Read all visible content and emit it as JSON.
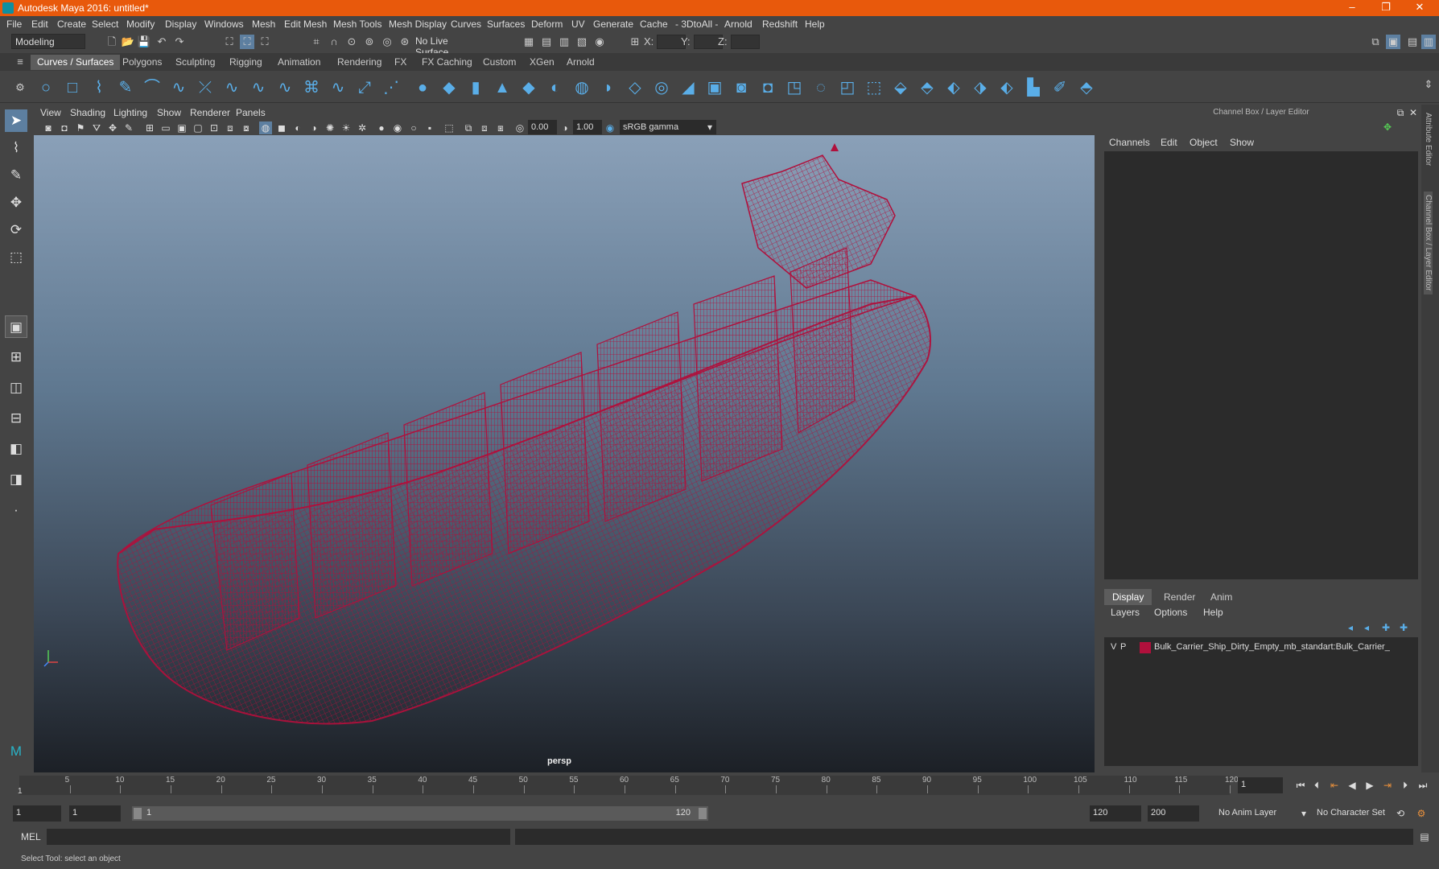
{
  "window": {
    "title": "Autodesk Maya 2016: untitled*"
  },
  "menus": [
    "File",
    "Edit",
    "Create",
    "Select",
    "Modify",
    "Display",
    "Windows",
    "Mesh",
    "Edit Mesh",
    "Mesh Tools",
    "Mesh Display",
    "Curves",
    "Surfaces",
    "Deform",
    "UV",
    "Generate",
    "Cache",
    "- 3DtoAll -",
    "Arnold",
    "Redshift",
    "Help"
  ],
  "toolbar": {
    "mode": "Modeling",
    "live_surface": "No Live Surface",
    "x_label": "X:",
    "y_label": "Y:",
    "z_label": "Z:"
  },
  "shelf_tabs": [
    "Curves / Surfaces",
    "Polygons",
    "Sculpting",
    "Rigging",
    "Animation",
    "Rendering",
    "FX",
    "FX Caching",
    "Custom",
    "XGen",
    "Arnold"
  ],
  "viewport": {
    "menus": [
      "View",
      "Shading",
      "Lighting",
      "Show",
      "Renderer",
      "Panels"
    ],
    "exposure": "0.00",
    "gamma": "1.00",
    "color_space": "sRGB gamma",
    "camera_label": "persp",
    "wire_color": "#b0103c"
  },
  "channel_box": {
    "title": "Channel Box / Layer Editor",
    "menus": [
      "Channels",
      "Edit",
      "Object",
      "Show"
    ]
  },
  "layer_editor": {
    "tabs": [
      "Display",
      "Render",
      "Anim"
    ],
    "menus": [
      "Layers",
      "Options",
      "Help"
    ],
    "layers": [
      {
        "v": "V",
        "p": "P",
        "name": "Bulk_Carrier_Ship_Dirty_Empty_mb_standart:Bulk_Carrier_",
        "color": "#b0103c"
      }
    ]
  },
  "side_tabs": [
    "Attribute Editor",
    "Channel Box / Layer Editor"
  ],
  "timeline": {
    "ticks": [
      "5",
      "10",
      "15",
      "20",
      "25",
      "30",
      "35",
      "40",
      "45",
      "50",
      "55",
      "60",
      "65",
      "70",
      "75",
      "80",
      "85",
      "90",
      "95",
      "100",
      "105",
      "110",
      "115",
      "120"
    ],
    "start_marker": "1",
    "current_frame": "1"
  },
  "range": {
    "start": "1",
    "playback_start": "1",
    "slider_start": "1",
    "slider_end": "120",
    "playback_end": "120",
    "end": "200",
    "anim_layer": "No Anim Layer",
    "character_set": "No Character Set"
  },
  "mel": {
    "label": "MEL"
  },
  "status": {
    "text": "Select Tool: select an object"
  }
}
